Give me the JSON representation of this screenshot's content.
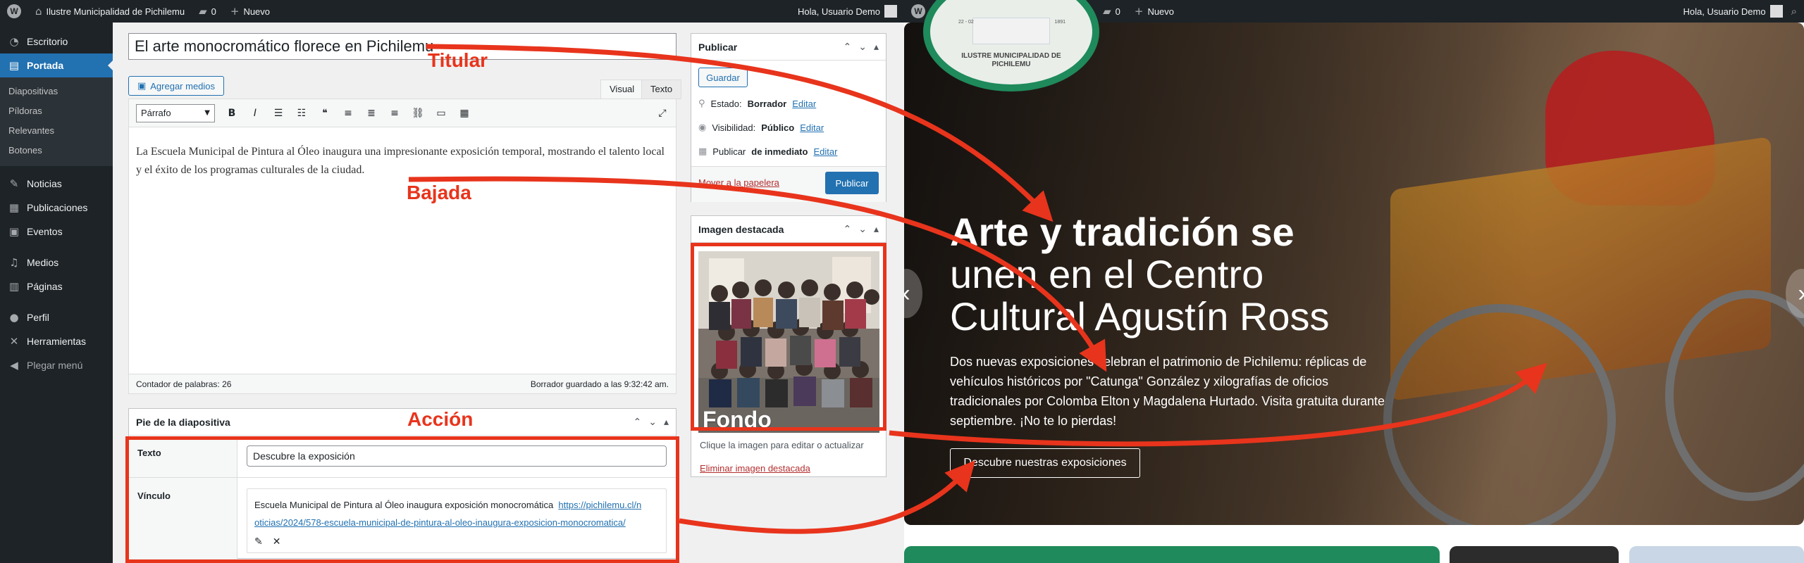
{
  "adminbar": {
    "site": "Ilustre Municipalidad de Pichilemu",
    "comments": "0",
    "new": "Nuevo",
    "greeting": "Hola, Usuario Demo"
  },
  "sidebar": {
    "items": [
      {
        "label": "Escritorio",
        "icon": "dashboard-icon"
      },
      {
        "label": "Portada",
        "icon": "portada-icon",
        "active": true
      },
      {
        "label": "Noticias",
        "icon": "pin-icon"
      },
      {
        "label": "Publicaciones",
        "icon": "posts-icon"
      },
      {
        "label": "Eventos",
        "icon": "calendar-icon"
      },
      {
        "label": "Medios",
        "icon": "media-icon"
      },
      {
        "label": "Páginas",
        "icon": "pages-icon"
      },
      {
        "label": "Perfil",
        "icon": "user-icon"
      },
      {
        "label": "Herramientas",
        "icon": "tools-icon"
      },
      {
        "label": "Plegar menú",
        "icon": "collapse-icon"
      }
    ],
    "submenu": [
      "Diapositivas",
      "Píldoras",
      "Relevantes",
      "Botones"
    ]
  },
  "editor": {
    "title": "El arte monocromático florece en Pichilemu",
    "add_media": "Agregar medios",
    "tab_visual": "Visual",
    "tab_text": "Texto",
    "format": "Párrafo",
    "content": "La Escuela Municipal de Pintura al Óleo inaugura una impresionante exposición temporal, mostrando el talento local y el éxito de los programas culturales de la ciudad.",
    "word_count": "Contador de palabras: 26",
    "saved": "Borrador guardado a las 9:32:42 am."
  },
  "caption_box": {
    "title": "Pie de la diapositiva",
    "text_label": "Texto",
    "text_value": "Descubre la exposición",
    "link_label": "Vínculo",
    "link_title": "Escuela Municipal de Pintura al Óleo inaugura exposición monocromática",
    "link_url_1": "https://pichilemu.cl/n",
    "link_url_2": "oticias/2024/578-escuela-municipal-de-pintura-al-oleo-inaugura-exposicion-monocromatica/"
  },
  "publish": {
    "title": "Publicar",
    "save": "Guardar",
    "status_label": "Estado:",
    "status_value": "Borrador",
    "visibility_label": "Visibilidad:",
    "visibility_value": "Público",
    "schedule_label": "Publicar",
    "schedule_value": "de inmediato",
    "edit": "Editar",
    "trash": "Mover a la papelera",
    "publish_btn": "Publicar"
  },
  "featured": {
    "title": "Imagen destacada",
    "hint": "Clique la imagen para editar o actualizar",
    "remove": "Eliminar imagen destacada"
  },
  "annotations": {
    "titular": "Titular",
    "bajada": "Bajada",
    "accion": "Acción",
    "fondo": "Fondo"
  },
  "logo": {
    "text": "ILUSTRE MUNICIPALIDAD DE PICHILEMU",
    "left": "22 - 02",
    "right": "1891"
  },
  "hero": {
    "title_bold": "Arte y tradición se",
    "title_rest_1": "unen en el Centro",
    "title_rest_2": "Cultural Agustín Ross",
    "lead": "Dos nuevas exposiciones celebran el patrimonio de Pichilemu: réplicas de vehículos históricos por \"Catunga\" González y xilografías de oficios tradicionales por Colomba Elton y Magdalena Hurtado. Visita gratuita durante septiembre. ¡No te lo pierdas!",
    "button": "Descubre nuestras exposiciones"
  },
  "colors": {
    "accent": "#e8341c",
    "wp_blue": "#2271b1",
    "admin_dark": "#1d2327",
    "green": "#1f8a5b"
  }
}
